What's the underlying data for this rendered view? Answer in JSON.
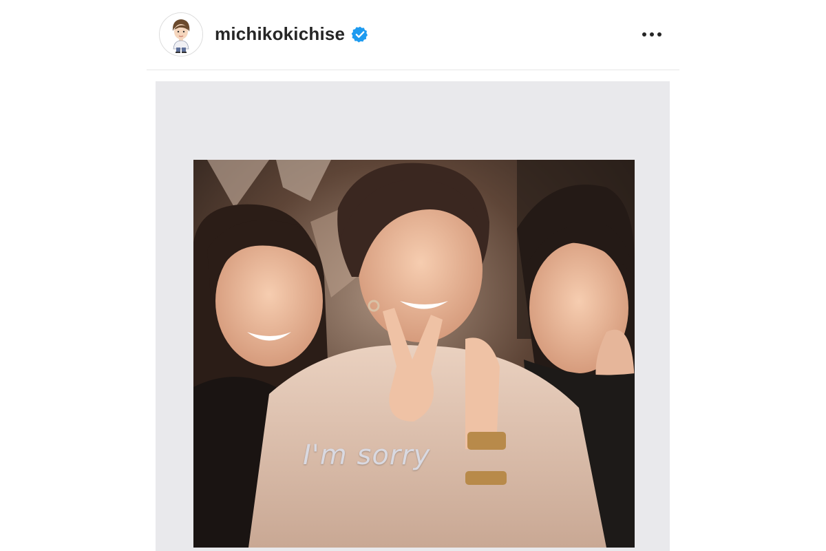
{
  "header": {
    "username": "michikokichise",
    "verified_icon": "verified-badge-icon",
    "more_icon": "more-options-icon"
  },
  "post": {
    "image_overlay_text": "I'm sorry"
  },
  "colors": {
    "verified": "#1e9bf0",
    "frame_bg": "#e9e9ec",
    "text": "#262626"
  }
}
